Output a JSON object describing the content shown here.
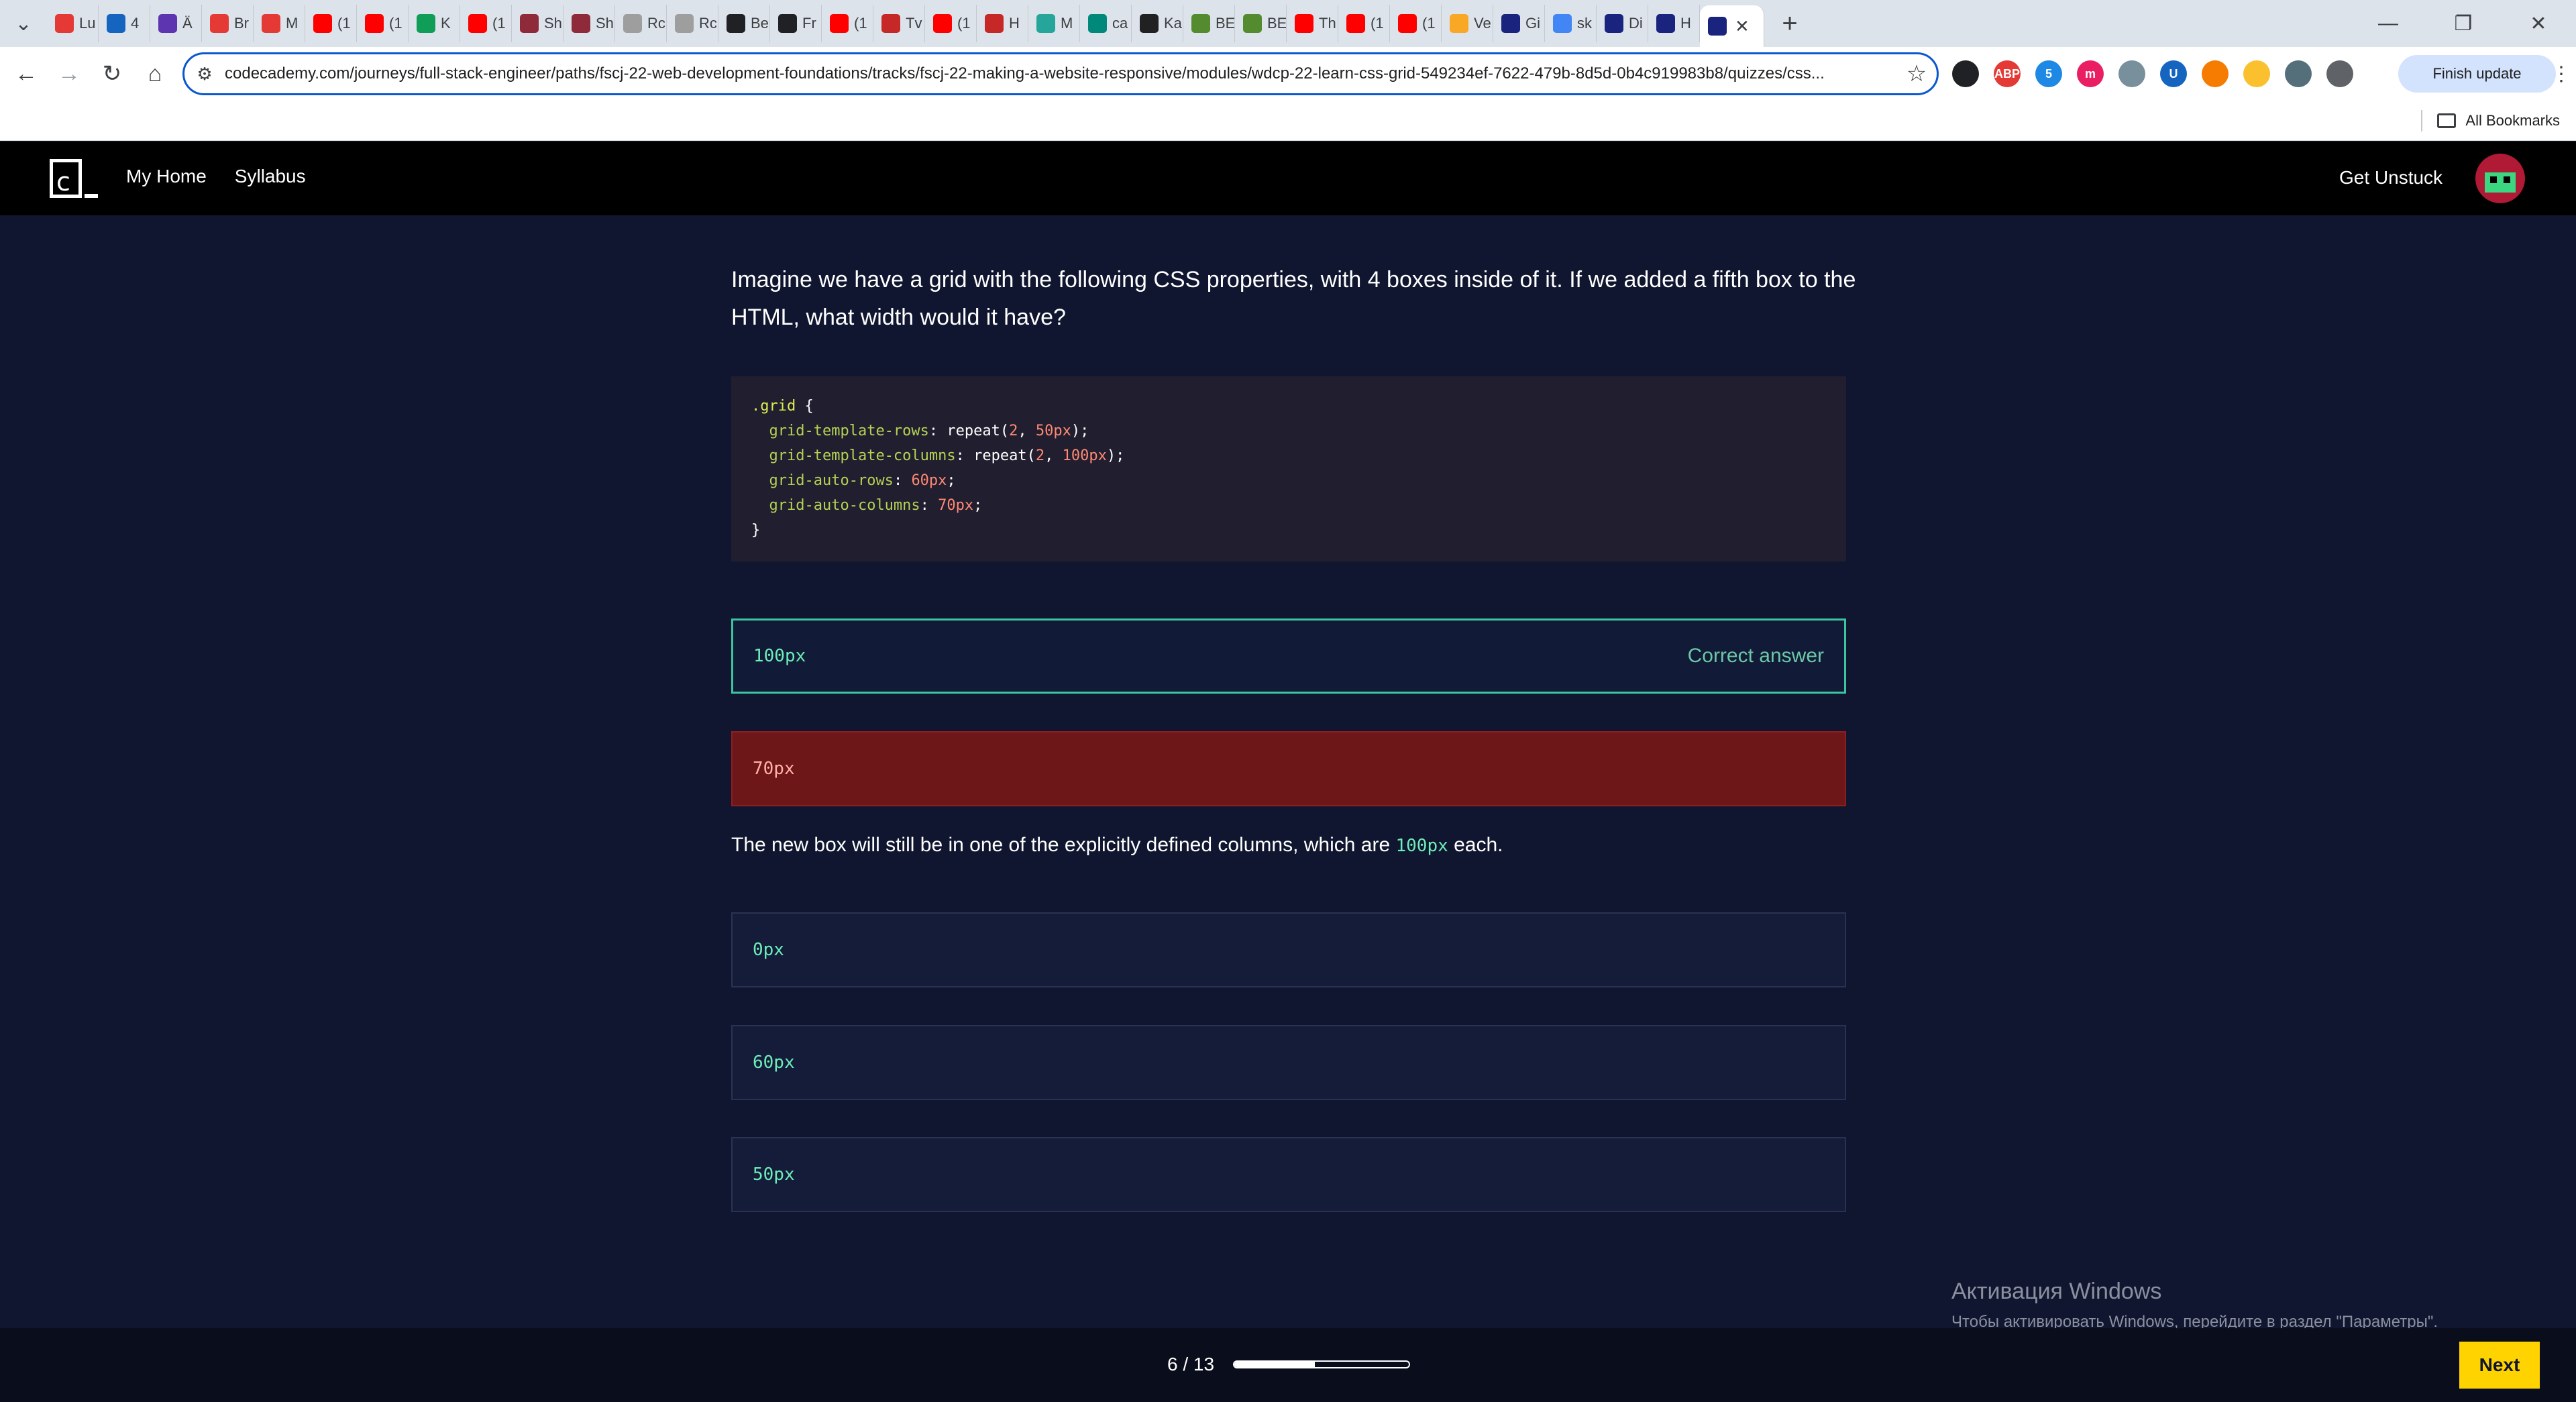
{
  "browser": {
    "tabs": [
      {
        "label": "Lu",
        "color": "#e53935"
      },
      {
        "label": "4",
        "color": "#1565c0"
      },
      {
        "label": "Ä",
        "color": "#5e35b1"
      },
      {
        "label": "Br",
        "color": "#e53935"
      },
      {
        "label": "M",
        "color": "#e53935"
      },
      {
        "label": "(1",
        "color": "#ff0000"
      },
      {
        "label": "(1",
        "color": "#ff0000"
      },
      {
        "label": "K",
        "color": "#0f9d58"
      },
      {
        "label": "(1",
        "color": "#ff0000"
      },
      {
        "label": "Sh",
        "color": "#8e2a3a"
      },
      {
        "label": "Sh",
        "color": "#8e2a3a"
      },
      {
        "label": "Rc",
        "color": "#9e9e9e"
      },
      {
        "label": "Rc",
        "color": "#9e9e9e"
      },
      {
        "label": "Be",
        "color": "#202124"
      },
      {
        "label": "Fr",
        "color": "#202124"
      },
      {
        "label": "(1",
        "color": "#ff0000"
      },
      {
        "label": "Tv",
        "color": "#c62828"
      },
      {
        "label": "(1",
        "color": "#ff0000"
      },
      {
        "label": "H",
        "color": "#c62828"
      },
      {
        "label": "M",
        "color": "#26a69a"
      },
      {
        "label": "ca",
        "color": "#00897b"
      },
      {
        "label": "Ka",
        "color": "#212121"
      },
      {
        "label": "BE",
        "color": "#558b2f"
      },
      {
        "label": "BE",
        "color": "#558b2f"
      },
      {
        "label": "Th",
        "color": "#ff0000"
      },
      {
        "label": "(1",
        "color": "#ff0000"
      },
      {
        "label": "(1",
        "color": "#ff0000"
      },
      {
        "label": "Ve",
        "color": "#f9a825"
      },
      {
        "label": "Gi",
        "color": "#1a237e"
      },
      {
        "label": "sk",
        "color": "#4285f4"
      },
      {
        "label": "Di",
        "color": "#1a237e"
      },
      {
        "label": "H",
        "color": "#1a237e"
      }
    ],
    "url": "codecademy.com/journeys/full-stack-engineer/paths/fscj-22-web-development-foundations/tracks/fscj-22-making-a-website-responsive/modules/wdcp-22-learn-css-grid-549234ef-7622-479b-8d5d-0b4c919983b8/quizzes/css...",
    "extensions": [
      {
        "name": "circle-extension-icon",
        "color": "#202124",
        "label": ""
      },
      {
        "name": "adblock-icon",
        "color": "#e53935",
        "label": "ABP"
      },
      {
        "name": "extension-badge-5-icon",
        "color": "#1e88e5",
        "label": "5"
      },
      {
        "name": "pinterest-style-icon",
        "color": "#e91e63",
        "label": "m"
      },
      {
        "name": "extension-badge-icon",
        "color": "#78909c",
        "label": ""
      },
      {
        "name": "bitwarden-icon",
        "color": "#1565c0",
        "label": "U"
      },
      {
        "name": "metamask-icon",
        "color": "#f57c00",
        "label": ""
      },
      {
        "name": "bolt-extension-icon",
        "color": "#fbc02d",
        "label": ""
      },
      {
        "name": "gear-extension-icon",
        "color": "#546e7a",
        "label": ""
      },
      {
        "name": "puzzle-icon",
        "color": "#5f6368",
        "label": ""
      }
    ],
    "finish_update": "Finish update",
    "all_bookmarks": "All Bookmarks"
  },
  "header": {
    "logo_letter": "c",
    "nav": [
      "My Home",
      "Syllabus"
    ],
    "get_unstuck": "Get Unstuck"
  },
  "quiz": {
    "question": "Imagine we have a grid with the following CSS properties, with 4 boxes inside of it. If we added a fifth box to the HTML, what width would it have?",
    "code": {
      "selector": ".grid",
      "open_brace": " {",
      "lines": [
        {
          "prop": "grid-template-rows",
          "before": "repeat(",
          "num1": "2",
          "mid": ", ",
          "num2": "50px",
          "after": ");"
        },
        {
          "prop": "grid-template-columns",
          "before": "repeat(",
          "num1": "2",
          "mid": ", ",
          "num2": "100px",
          "after": ");"
        },
        {
          "prop": "grid-auto-rows",
          "before": "",
          "num1": "",
          "mid": "",
          "num2": "60px",
          "after": ";"
        },
        {
          "prop": "grid-auto-columns",
          "before": "",
          "num1": "",
          "mid": "",
          "num2": "70px",
          "after": ";"
        }
      ],
      "close_brace": "}"
    },
    "answers": [
      {
        "label": "100px",
        "state": "correct",
        "flag": "Correct answer"
      },
      {
        "label": "70px",
        "state": "wrong",
        "flag": ""
      },
      {
        "label": "0px",
        "state": "neutral",
        "flag": ""
      },
      {
        "label": "60px",
        "state": "neutral",
        "flag": ""
      },
      {
        "label": "50px",
        "state": "neutral",
        "flag": ""
      }
    ],
    "explanation": {
      "before": "The new box will still be in one of the explicitly defined columns, which are ",
      "code": "100px",
      "after": " each."
    }
  },
  "watermark": {
    "line1": "Активация Windows",
    "line2": "Чтобы активировать Windows, перейдите в раздел \"Параметры\"."
  },
  "footer": {
    "progress_label": "6 / 13",
    "progress_fraction": 0.4615,
    "next_label": "Next"
  }
}
